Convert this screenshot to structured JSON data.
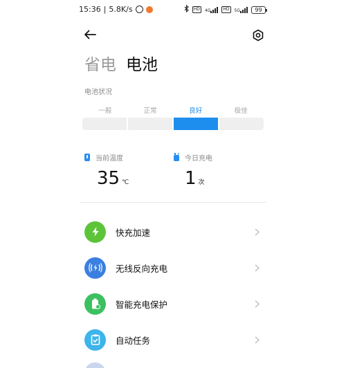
{
  "status_bar": {
    "time": "15:36",
    "separator": "|",
    "net_speed": "5.8K/s",
    "net_tag_1": "4G",
    "net_tag_2": "5G",
    "hd_tag": "HD",
    "battery_level": "99"
  },
  "header": {
    "tabs": [
      {
        "label": "省电",
        "active": false
      },
      {
        "label": "电池",
        "active": true
      }
    ],
    "back_icon": "arrow-left-icon",
    "settings_icon": "gear-icon"
  },
  "battery_status": {
    "title": "电池状况",
    "levels": [
      "一般",
      "正常",
      "良好",
      "极佳"
    ],
    "selected_level": "良好",
    "accent_color": "#1e8eee"
  },
  "stats": {
    "temperature": {
      "label": "当前温度",
      "value": "35",
      "unit": "℃"
    },
    "charges_today": {
      "label": "今日充电",
      "value": "1",
      "unit": "次"
    }
  },
  "list": [
    {
      "label": "快充加速",
      "icon": "lightning-icon",
      "color": "#5dc43a"
    },
    {
      "label": "无线反向充电",
      "icon": "wireless-charging-icon",
      "color": "#3b7fe0"
    },
    {
      "label": "智能充电保护",
      "icon": "battery-shield-icon",
      "color": "#3cc060"
    },
    {
      "label": "自动任务",
      "icon": "clipboard-check-icon",
      "color": "#3db4ea"
    }
  ]
}
